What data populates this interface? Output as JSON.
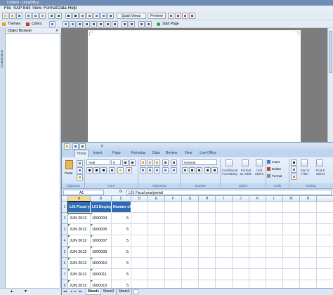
{
  "window": {
    "title": "Untitled - LibreOffice"
  },
  "menu": [
    "File",
    "SAP",
    "Edit",
    "View",
    "Format",
    "Data",
    "Help"
  ],
  "toolbar": {
    "quick_views": "Quick Views",
    "preview": "Preview",
    "themes": "Themes",
    "colors": "Colors",
    "start_page": "Start Page"
  },
  "object_browser": {
    "title": "Object Browser",
    "side_tab": "Connections"
  },
  "excel": {
    "qat_title": "x",
    "tabs": [
      "Home",
      "Insert",
      "Page Layout",
      "Formulas",
      "Data",
      "Review",
      "View",
      "Live Office"
    ],
    "font": {
      "name": "Arial",
      "size": "9"
    },
    "number_format": "General",
    "paste_label": "Paste",
    "buttons": {
      "conditional": "Conditional Formatting",
      "format_table": "Format as Table",
      "cell_styles": "Cell Styles",
      "insert": "Insert",
      "delete": "Delete",
      "format": "Format",
      "sort": "Sort & Filter",
      "find": "Find & Select"
    },
    "groups": [
      "Clipboard",
      "Font",
      "Alignment",
      "Number",
      "Styles",
      "Cells",
      "Editing"
    ],
    "name_box": "A1",
    "formula": "L01 Fiscal year/period",
    "fx": "fx",
    "columns": [
      "A",
      "B",
      "C",
      "D",
      "E",
      "F",
      "G",
      "H",
      "I",
      "J",
      "K",
      "L",
      "M",
      "N"
    ],
    "headers": [
      "L01 Fiscal year/period",
      "L01 Employee",
      "Number of Employees"
    ],
    "header_display": [
      "L01 Fiscal yea",
      "L01 Employee",
      "Number of Em"
    ],
    "rows": [
      {
        "num": "1"
      },
      {
        "num": "2",
        "a": "JUN 2012",
        "b": "1000004",
        "c": "5"
      },
      {
        "num": "3",
        "a": "JUN 2012",
        "b": "1000005",
        "c": "5"
      },
      {
        "num": "4",
        "a": "JUN 2012",
        "b": "1000007",
        "c": "5"
      },
      {
        "num": "5",
        "a": "JUN 2012",
        "b": "1000009",
        "c": "5"
      },
      {
        "num": "6",
        "a": "JUN 2012",
        "b": "1000010",
        "c": "5"
      },
      {
        "num": "7",
        "a": "JUN 2012",
        "b": "1000011",
        "c": "5"
      },
      {
        "num": "8",
        "a": "JUN 2012",
        "b": "1000015",
        "c": "5"
      },
      {
        "num": "9",
        "a": "JUN 2012",
        "b": "1000016",
        "c": "5"
      }
    ],
    "sheets": [
      "Sheet1",
      "Sheet2",
      "Sheet3"
    ]
  },
  "colors": {
    "accent": "#2e67b1",
    "header_fill": "#2f6cb4",
    "ribbon": "#d5e3f5"
  }
}
